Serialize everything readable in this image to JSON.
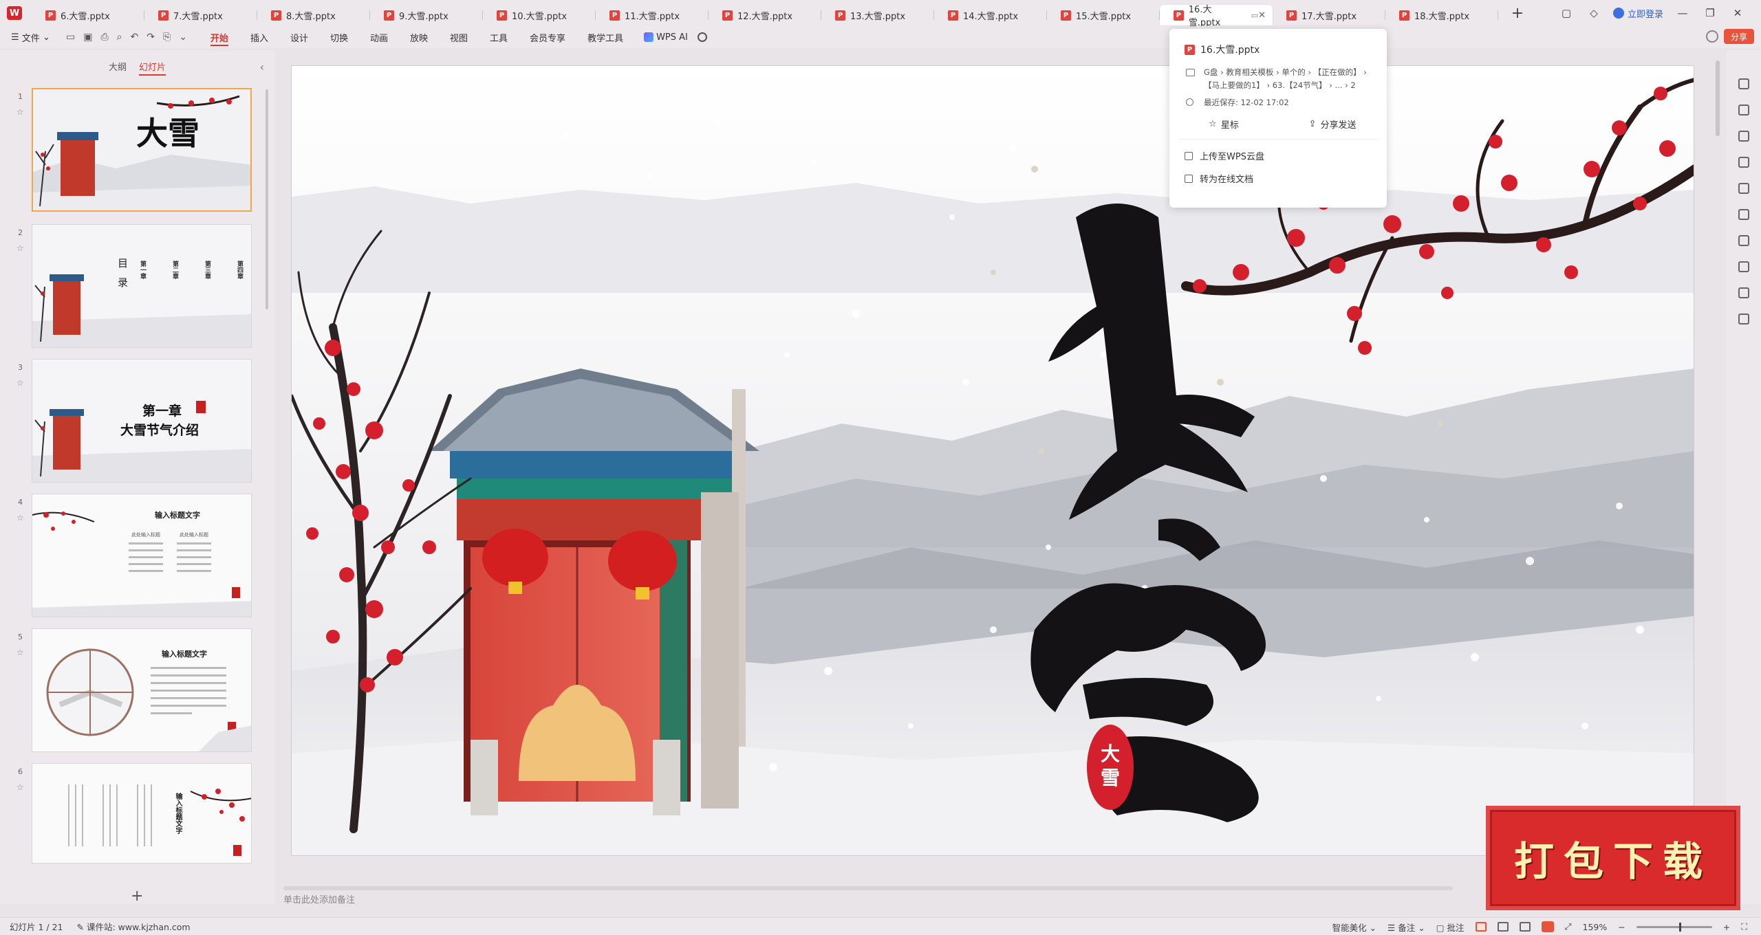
{
  "tabs": [
    {
      "label": "6.大雪.pptx",
      "active": false
    },
    {
      "label": "7.大雪.pptx",
      "active": false
    },
    {
      "label": "8.大雪.pptx",
      "active": false
    },
    {
      "label": "9.大雪.pptx",
      "active": false
    },
    {
      "label": "10.大雪.pptx",
      "active": false
    },
    {
      "label": "11.大雪.pptx",
      "active": false
    },
    {
      "label": "12.大雪.pptx",
      "active": false
    },
    {
      "label": "13.大雪.pptx",
      "active": false
    },
    {
      "label": "14.大雪.pptx",
      "active": false
    },
    {
      "label": "15.大雪.pptx",
      "active": false
    },
    {
      "label": "16.大雪.pptx",
      "active": true
    },
    {
      "label": "17.大雪.pptx",
      "active": false
    },
    {
      "label": "18.大雪.pptx",
      "active": false
    }
  ],
  "window": {
    "login_label": "立即登录"
  },
  "ribbon": {
    "file_label": "文件",
    "menus": [
      "开始",
      "插入",
      "设计",
      "切换",
      "动画",
      "放映",
      "视图",
      "工具",
      "会员专享",
      "教学工具"
    ],
    "active_menu": "开始",
    "wps_ai_label": "WPS AI",
    "share_label": "分享"
  },
  "left_panel": {
    "view_tabs": [
      "大纲",
      "幻灯片"
    ],
    "active_view": "幻灯片",
    "slides": [
      {
        "number": "1",
        "title": "大雪"
      },
      {
        "number": "2",
        "title": "目录",
        "items": [
          "第一章",
          "第二章",
          "第三章",
          "第四章"
        ]
      },
      {
        "number": "3",
        "title": "第一章",
        "subtitle": "大雪节气介绍"
      },
      {
        "number": "4",
        "title": "输入标题文字",
        "left_head": "此处输入标题",
        "right_head": "此处输入标题"
      },
      {
        "number": "5",
        "title": "输入标题文字"
      },
      {
        "number": "6",
        "title": "输入标题文字"
      }
    ]
  },
  "popup": {
    "filename": "16.大雪.pptx",
    "path_line1": "G盘 › 教育相关模板 › 单个的 › 【正在做的】 ›",
    "path_line2": "【马上要做的1】 › 63.【24节气】 › ... › 2",
    "saved": "最近保存: 12-02 17:02",
    "star_label": "星标",
    "share_label": "分享发送",
    "upload_label": "上传至WPS云盘",
    "convert_label": "转为在线文档"
  },
  "slide": {
    "title": "大雪",
    "seal": "大雪"
  },
  "notes_placeholder": "单击此处添加备注",
  "status": {
    "slide_counter": "幻灯片 1 / 21",
    "source": "课件站: www.kjzhan.com",
    "smart_label": "智能美化",
    "notes_label": "备注",
    "comment_label": "批注",
    "zoom": "159%"
  },
  "banner": {
    "label": "打包下载"
  },
  "colors": {
    "accent": "#d83b31",
    "plum": "#d4202c",
    "banner": "#d92b2b"
  }
}
